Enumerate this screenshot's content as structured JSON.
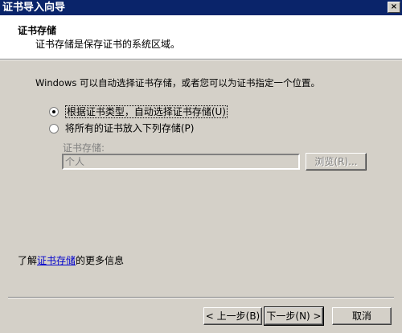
{
  "window": {
    "title": "证书导入向导",
    "close_glyph": "×"
  },
  "header": {
    "title": "证书存储",
    "subtitle": "证书存储是保存证书的系统区域。"
  },
  "main": {
    "description": "Windows 可以自动选择证书存储，或者您可以为证书指定一个位置。",
    "options": [
      {
        "label": "根据证书类型，自动选择证书存储(U)",
        "checked": true
      },
      {
        "label": "将所有的证书放入下列存储(P)",
        "checked": false
      }
    ],
    "store_label": "证书存储:",
    "store_value": "个人",
    "browse_label": "浏览(R)..."
  },
  "footer": {
    "learn_prefix": "了解",
    "learn_link": "证书存储",
    "learn_suffix": "的更多信息"
  },
  "buttons": {
    "back": "< 上一步(B)",
    "next": "下一步(N) >",
    "cancel": "取消"
  }
}
